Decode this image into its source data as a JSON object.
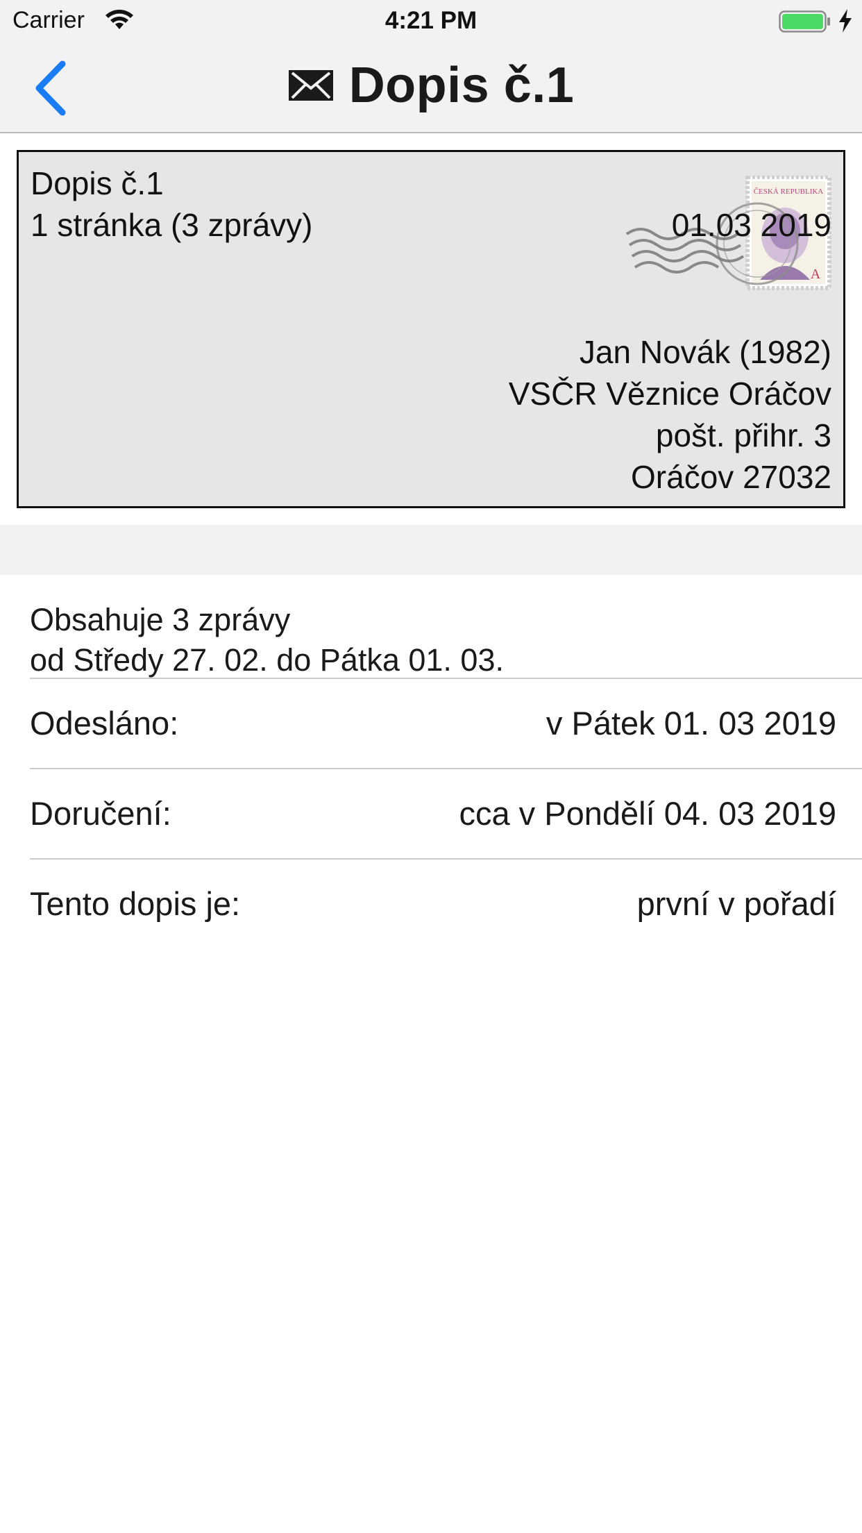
{
  "status_bar": {
    "carrier": "Carrier",
    "time": "4:21 PM",
    "battery_color": "#4cd964"
  },
  "nav": {
    "back_icon": "chevron-left-icon",
    "title_icon": "envelope-icon",
    "title": "Dopis č.1",
    "accent": "#1a7cf5"
  },
  "envelope": {
    "name": "Dopis č.1",
    "pages": "1 stránka (3 zprávy)",
    "date": "01.03 2019",
    "stamp": {
      "country": "ČESKÁ REPUBLIKA",
      "value": "A"
    },
    "address": [
      "Jan Novák (1982)",
      "VSČR Věznice Oráčov",
      "pošt. přihr. 3",
      "Oráčov 27032"
    ]
  },
  "details": {
    "summary_line1": "Obsahuje 3 zprávy",
    "summary_line2": "od Středy 27. 02. do Pátka 01. 03.",
    "rows": [
      {
        "label": "Odesláno:",
        "value": "v Pátek 01. 03 2019"
      },
      {
        "label": "Doručení:",
        "value": "cca v Pondělí 04. 03 2019"
      },
      {
        "label": "Tento dopis je:",
        "value": "první v pořadí"
      }
    ]
  }
}
